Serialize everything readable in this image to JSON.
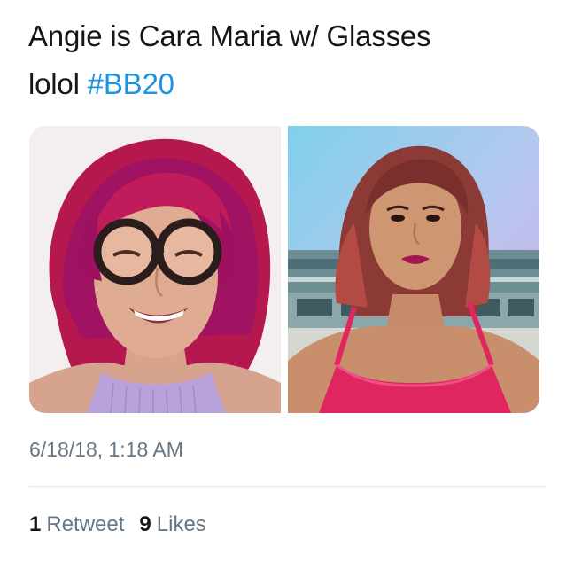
{
  "tweet": {
    "text_line1": "Angie is Cara Maria w/ Glasses",
    "text_line2_prefix": "lolol ",
    "hashtag": "#BB20",
    "timestamp": "6/18/18, 1:18 AM"
  },
  "media": {
    "left_photo": "photo of woman with magenta hair and round glasses",
    "right_photo": "photo of woman with reddish hair in pink top"
  },
  "stats": {
    "retweets_count": "1",
    "retweets_label": "Retweet",
    "likes_count": "9",
    "likes_label": "Likes"
  },
  "colors": {
    "text": "#14171a",
    "link": "#1b95e0",
    "secondary": "#657786",
    "divider": "#e1e8ed"
  }
}
